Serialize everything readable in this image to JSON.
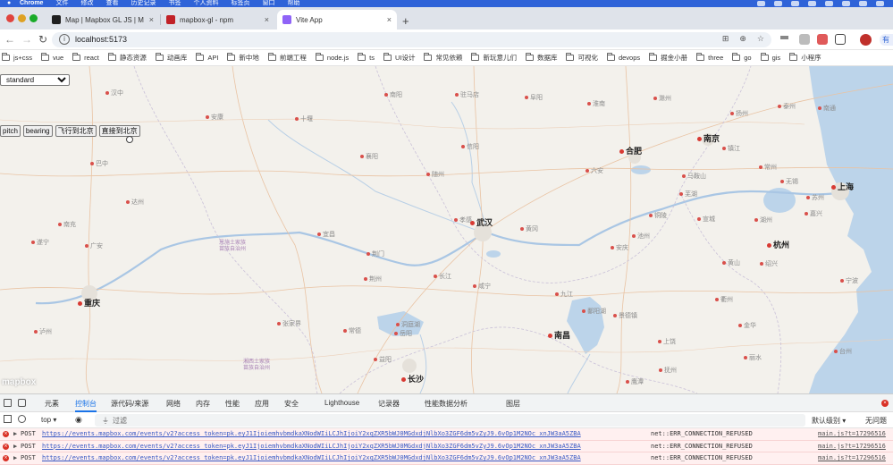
{
  "menubar": {
    "items": [
      "Chrome",
      "文件",
      "修改",
      "查看",
      "历史记录",
      "书签",
      "个人资料",
      "标签页",
      "窗口",
      "帮助"
    ]
  },
  "tabs": [
    {
      "title": "Map | Mapbox GL JS | Mapbo",
      "favicon_color": "#1f1f1f",
      "active": false
    },
    {
      "title": "mapbox-gl - npm",
      "favicon_color": "#c12127",
      "active": false
    },
    {
      "title": "Vite App",
      "favicon_color": "#8f63f7",
      "active": true
    }
  ],
  "toolbar": {
    "url": "localhost:5173",
    "profile_initial": "",
    "profile_label": "有新"
  },
  "bookmarks": [
    "js+css",
    "vue",
    "react",
    "静态资源",
    "动画库",
    "API",
    "新中地",
    "前端工程",
    "node.js",
    "ts",
    "UI设计",
    "常见依赖",
    "新玩意儿们",
    "数据库",
    "可视化",
    "devops",
    "掘金小册",
    "three",
    "go",
    "gis",
    "小程序"
  ],
  "map": {
    "style_select": {
      "selected": "standard"
    },
    "buttons": [
      "pitch",
      "bearing",
      "飞行到北京",
      "直接到北京"
    ],
    "logo": "mapbox",
    "water_color": "#bcd4ea",
    "land_color": "#f3f1ec",
    "cities": [
      {
        "name": "汉中",
        "major": false
      },
      {
        "name": "安康",
        "major": false
      },
      {
        "name": "南阳",
        "major": false
      },
      {
        "name": "驻马店",
        "major": false
      },
      {
        "name": "十堰",
        "major": false
      },
      {
        "name": "阜阳",
        "major": false
      },
      {
        "name": "淮南",
        "major": false
      },
      {
        "name": "滁州",
        "major": false
      },
      {
        "name": "扬州",
        "major": false
      },
      {
        "name": "泰州",
        "major": false
      },
      {
        "name": "南通",
        "major": false
      },
      {
        "name": "信阳",
        "major": false
      },
      {
        "name": "合肥",
        "major": true
      },
      {
        "name": "六安",
        "major": false
      },
      {
        "name": "南京",
        "major": true
      },
      {
        "name": "镇江",
        "major": false
      },
      {
        "name": "常州",
        "major": false
      },
      {
        "name": "无锡",
        "major": false
      },
      {
        "name": "上海",
        "major": true
      },
      {
        "name": "巴中",
        "major": false
      },
      {
        "name": "襄阳",
        "major": false
      },
      {
        "name": "随州",
        "major": false
      },
      {
        "name": "马鞍山",
        "major": false
      },
      {
        "name": "芜湖",
        "major": false
      },
      {
        "name": "苏州",
        "major": false
      },
      {
        "name": "达州",
        "major": false
      },
      {
        "name": "孝感",
        "major": false
      },
      {
        "name": "武汉",
        "major": true
      },
      {
        "name": "铜陵",
        "major": false
      },
      {
        "name": "宣城",
        "major": false
      },
      {
        "name": "湖州",
        "major": false
      },
      {
        "name": "嘉兴",
        "major": false
      },
      {
        "name": "南充",
        "major": false
      },
      {
        "name": "宜昌",
        "major": false
      },
      {
        "name": "荆门",
        "major": false
      },
      {
        "name": "黄冈",
        "major": false
      },
      {
        "name": "池州",
        "major": false
      },
      {
        "name": "杭州",
        "major": true
      },
      {
        "name": "遂宁",
        "major": false
      },
      {
        "name": "广安",
        "major": false
      },
      {
        "name": "荆州",
        "major": false
      },
      {
        "name": "安庆",
        "major": false
      },
      {
        "name": "黄山",
        "major": false
      },
      {
        "name": "绍兴",
        "major": false
      },
      {
        "name": "宁波",
        "major": false
      },
      {
        "name": "长江",
        "major": false
      },
      {
        "name": "咸宁",
        "major": false
      },
      {
        "name": "九江",
        "major": false
      },
      {
        "name": "重庆",
        "major": true
      },
      {
        "name": "鄱阳湖",
        "major": false
      },
      {
        "name": "景德镇",
        "major": false
      },
      {
        "name": "衢州",
        "major": false
      },
      {
        "name": "张家界",
        "major": false
      },
      {
        "name": "岳阳",
        "major": false
      },
      {
        "name": "南昌",
        "major": true
      },
      {
        "name": "金华",
        "major": false
      },
      {
        "name": "泸州",
        "major": false
      },
      {
        "name": "常德",
        "major": false
      },
      {
        "name": "洞庭湖",
        "major": false
      },
      {
        "name": "台州",
        "major": false
      },
      {
        "name": "上饶",
        "major": false
      },
      {
        "name": "益阳",
        "major": false
      },
      {
        "name": "抚州",
        "major": false
      },
      {
        "name": "丽水",
        "major": false
      },
      {
        "name": "长沙",
        "major": true
      },
      {
        "name": "鹰潭",
        "major": false
      }
    ],
    "regions": [
      "恩施土家族\n苗族自治州",
      "湘西土家族\n苗族自治州"
    ]
  },
  "devtools": {
    "tabs": [
      "元素",
      "控制台",
      "源代码/来源",
      "网络",
      "内存",
      "性能",
      "应用",
      "安全",
      "Lighthouse",
      "记录器",
      "性能数据分析",
      "图层"
    ],
    "active_tab": "控制台",
    "console": {
      "context": "top",
      "filter_placeholder": "过滤",
      "levels": "默认级别",
      "issues": "无问题"
    },
    "log_rows": [
      {
        "method": "POST",
        "url": "https://events.mapbox.com/events/v2?access_token=pk.eyJ1IjoiemhvbmdkaXNodWIiLCJhIjoiY2xqZXR5bWJ0MGdxdjNlbXo3ZGF6dm5vZyJ9.6vOp1M2NOc_xnJW3aA5ZBA",
        "error": "net::ERR_CONNECTION_REFUSED",
        "source": "main.js?t=17296516"
      },
      {
        "method": "POST",
        "url": "https://events.mapbox.com/events/v2?access_token=pk.eyJ1IjoiemhvbmdkaXNodWIiLCJhIjoiY2xqZXR5bWJ0MGdxdjNlbXo3ZGF6dm5vZyJ9.6vOp1M2NOc_xnJW3aA5ZBA",
        "error": "net::ERR_CONNECTION_REFUSED",
        "source": "main.js?t=17296516"
      },
      {
        "method": "POST",
        "url": "https://events.mapbox.com/events/v2?access_token=pk.eyJ1IjoiemhvbmdkaXNodWIiLCJhIjoiY2xqZXR5bWJ0MGdxdjNlbXo3ZGF6dm5vZyJ9.6vOp1M2NOc_xnJW3aA5ZBA",
        "error": "net::ERR_CONNECTION_REFUSED",
        "source": "main.js?t=17296516"
      }
    ]
  }
}
